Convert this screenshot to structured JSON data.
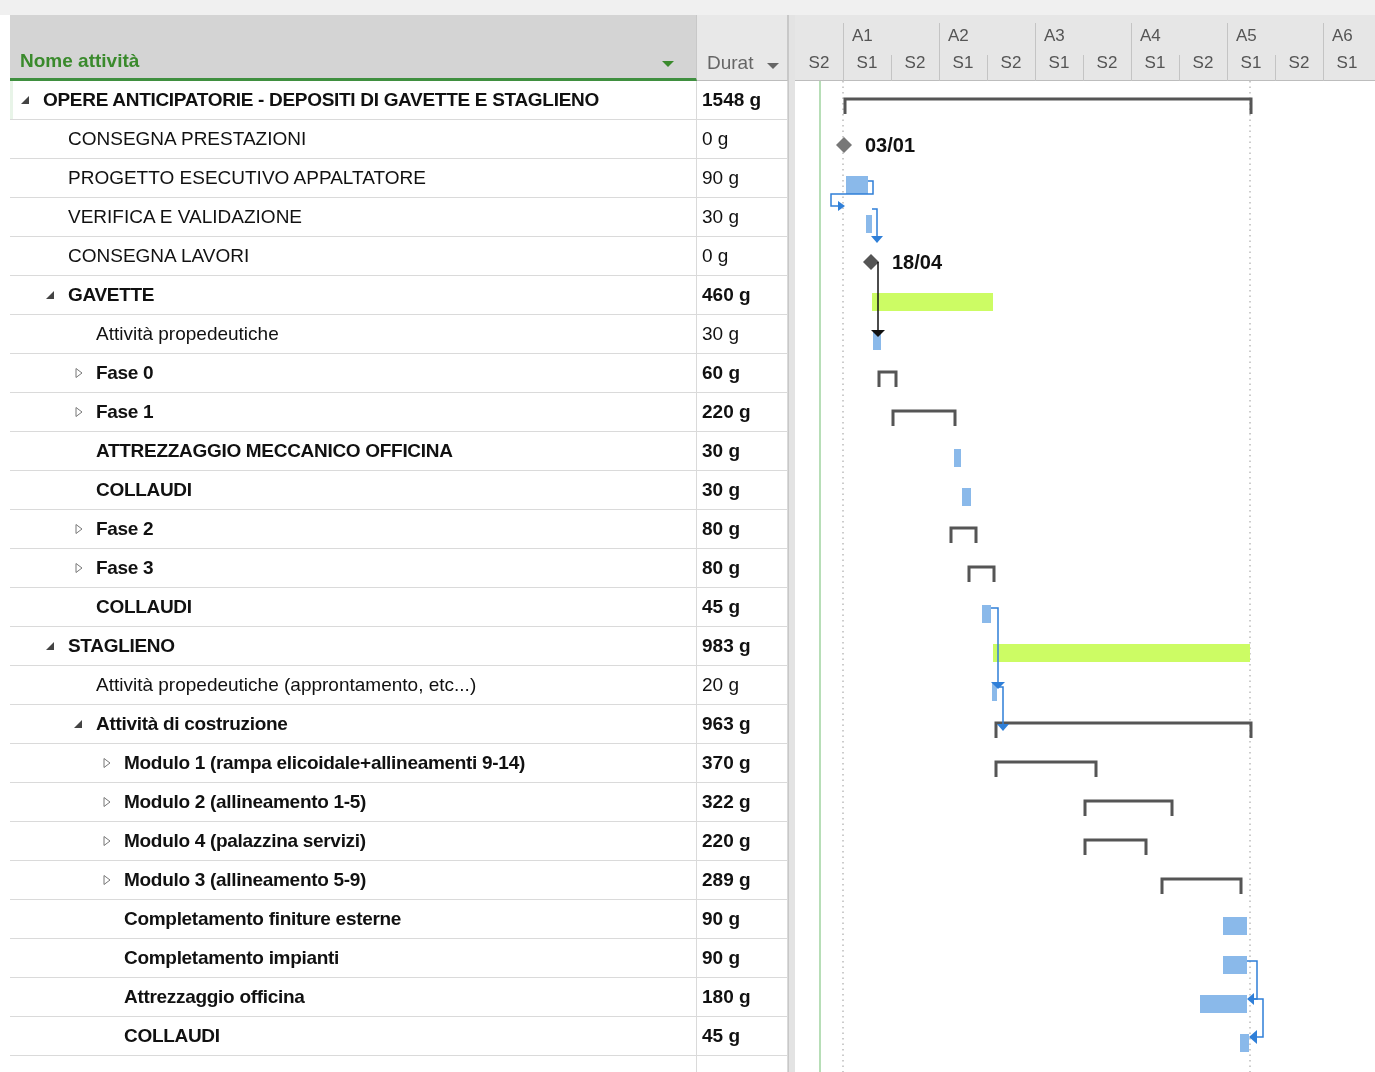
{
  "table": {
    "columns": [
      {
        "label": "Nome attività",
        "selected": true
      },
      {
        "label": "Durat",
        "selected": false
      }
    ],
    "rows": [
      {
        "name": "OPERE ANTICIPATORIE - DEPOSITI DI GAVETTE E STAGLIENO",
        "duration": "1548 g",
        "bold": true,
        "expanded": true,
        "children": [
          {
            "name": "CONSEGNA PRESTAZIONI",
            "duration": "0 g",
            "bold": false,
            "milestone_date": "03/01"
          },
          {
            "name": "PROGETTO ESECUTIVO APPALTATORE",
            "duration": "90 g",
            "bold": false
          },
          {
            "name": "VERIFICA E VALIDAZIONE",
            "duration": "30 g",
            "bold": false
          },
          {
            "name": "CONSEGNA LAVORI",
            "duration": "0 g",
            "bold": false,
            "milestone_date": "18/04"
          },
          {
            "name": "GAVETTE",
            "duration": "460 g",
            "bold": true,
            "expanded": true,
            "children": [
              {
                "name": "Attività propedeutiche",
                "duration": "30 g",
                "bold": false
              },
              {
                "name": "Fase 0",
                "duration": "60 g",
                "bold": true,
                "expanded": false
              },
              {
                "name": "Fase 1",
                "duration": "220 g",
                "bold": true,
                "expanded": false
              },
              {
                "name": "ATTREZZAGGIO MECCANICO OFFICINA",
                "duration": "30 g",
                "bold": true
              },
              {
                "name": "COLLAUDI",
                "duration": "30 g",
                "bold": true
              },
              {
                "name": "Fase 2",
                "duration": "80 g",
                "bold": true,
                "expanded": false
              },
              {
                "name": "Fase 3",
                "duration": "80 g",
                "bold": true,
                "expanded": false
              },
              {
                "name": "COLLAUDI",
                "duration": "45 g",
                "bold": true
              }
            ]
          },
          {
            "name": "STAGLIENO",
            "duration": "983 g",
            "bold": true,
            "expanded": true,
            "children": [
              {
                "name": "Attività propedeutiche (approntamento, etc...)",
                "duration": "20 g",
                "bold": false
              },
              {
                "name": "Attività di costruzione",
                "duration": "963 g",
                "bold": true,
                "expanded": true,
                "children": [
                  {
                    "name": "Modulo 1 (rampa elicoidale+allineamenti 9-14)",
                    "duration": "370 g",
                    "bold": true,
                    "expanded": false
                  },
                  {
                    "name": "Modulo 2 (allineamento 1-5)",
                    "duration": "322 g",
                    "bold": true,
                    "expanded": false
                  },
                  {
                    "name": "Modulo 4 (palazzina servizi)",
                    "duration": "220 g",
                    "bold": true,
                    "expanded": false
                  },
                  {
                    "name": "Modulo 3 (allineamento 5-9)",
                    "duration": "289 g",
                    "bold": true,
                    "expanded": false
                  },
                  {
                    "name": "Completamento finiture esterne",
                    "duration": "90 g",
                    "bold": true
                  },
                  {
                    "name": "Completamento impianti",
                    "duration": "90 g",
                    "bold": true
                  },
                  {
                    "name": "Attrezzaggio officina",
                    "duration": "180 g",
                    "bold": true
                  },
                  {
                    "name": "COLLAUDI",
                    "duration": "45 g",
                    "bold": true
                  }
                ]
              }
            ]
          }
        ]
      }
    ]
  },
  "timescale": {
    "years": [
      "A1",
      "A2",
      "A3",
      "A4",
      "A5",
      "A6"
    ],
    "semesters": [
      "S2",
      "S1",
      "S2",
      "S1",
      "S2",
      "S1",
      "S2",
      "S1",
      "S2",
      "S1",
      "S2",
      "S1"
    ]
  }
}
